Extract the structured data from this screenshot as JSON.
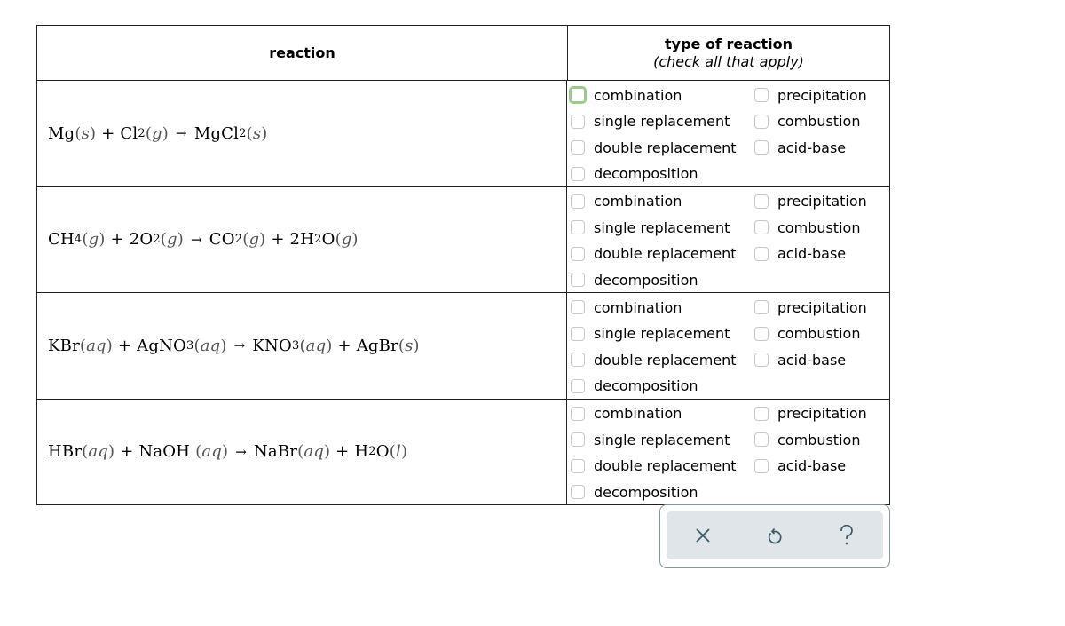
{
  "table": {
    "header": {
      "reaction": "reaction",
      "type_title": "type of reaction",
      "type_subtitle": "(check all that apply)"
    },
    "options_left": [
      "combination",
      "single replacement",
      "double replacement",
      "decomposition"
    ],
    "options_right": [
      "precipitation",
      "combustion",
      "acid-base"
    ],
    "rows": [
      {
        "equation": "Mg(s) + Cl2(g) → MgCl2(s)",
        "checked": [],
        "focused": "combination"
      },
      {
        "equation": "CH4(g) + 2O2(g) → CO2(g) + 2H2O(g)",
        "checked": []
      },
      {
        "equation": "KBr(aq) + AgNO3(aq) → KNO3(aq) + AgBr(s)",
        "checked": []
      },
      {
        "equation": "HBr(aq) + NaOH(aq) → NaBr(aq) + H2O(l)",
        "checked": []
      }
    ]
  },
  "eq": {
    "plus": "+",
    "arrow": "→",
    "r1": {
      "a": "Mg",
      "a_ph": "s",
      "b": "Cl",
      "b_sub": "2",
      "b_ph": "g",
      "c": "MgCl",
      "c_sub": "2",
      "c_ph": "s"
    },
    "r2": {
      "a": "CH",
      "a_sub": "4",
      "a_ph": "g",
      "b": "2O",
      "b_sub": "2",
      "b_ph": "g",
      "c": "CO",
      "c_sub": "2",
      "c_ph": "g",
      "d": "2H",
      "d_sub": "2",
      "d2": "O",
      "d_ph": "g"
    },
    "r3": {
      "a": "KBr",
      "a_ph": "aq",
      "b": "AgNO",
      "b_sub": "3",
      "b_ph": "aq",
      "c": "KNO",
      "c_sub": "3",
      "c_ph": "aq",
      "d": "AgBr",
      "d_ph": "s"
    },
    "r4": {
      "a": "HBr",
      "a_ph": "aq",
      "b": "NaOH",
      "b_ph": "aq",
      "c": "NaBr",
      "c_ph": "aq",
      "d": "H",
      "d_sub": "2",
      "d2": "O",
      "d_ph": "l"
    }
  },
  "toolbar": {
    "clear_icon": "×",
    "undo_icon": "↺",
    "help_icon": "?"
  },
  "colors": {
    "focus_ring": "#9acb8c",
    "toolbar_bg": "#dfe5e8",
    "toolbar_icon": "#3c5a66"
  }
}
